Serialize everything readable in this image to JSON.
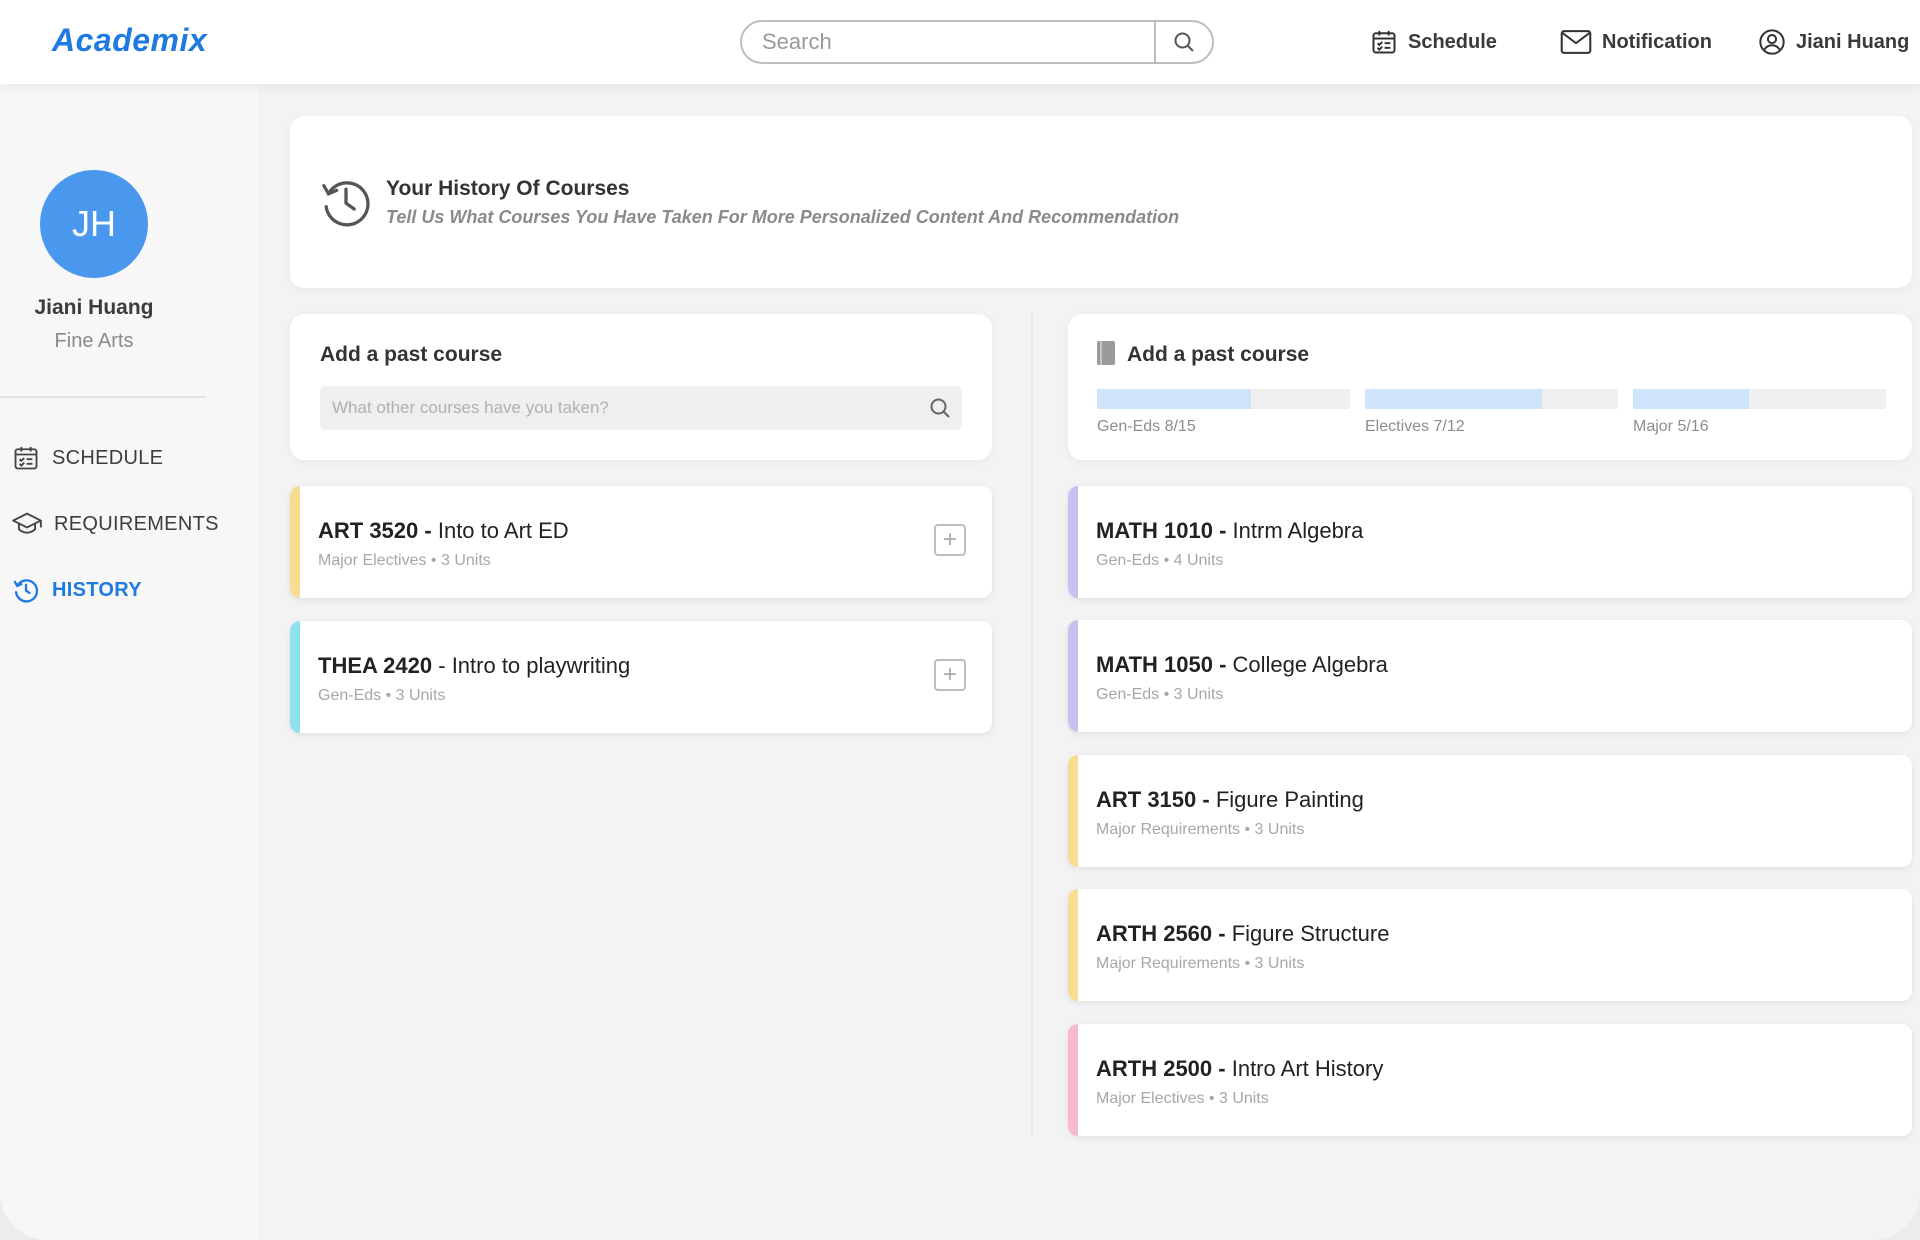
{
  "header": {
    "logo": "Academix",
    "search_placeholder": "Search",
    "nav": {
      "schedule": "Schedule",
      "notification": "Notification",
      "user": "Jiani Huang"
    }
  },
  "sidebar": {
    "avatar_initials": "JH",
    "name": "Jiani Huang",
    "major": "Fine Arts",
    "items": [
      {
        "label": "SCHEDULE",
        "icon": "calendar-icon",
        "active": false
      },
      {
        "label": "REQUIREMENTS",
        "icon": "graduation-cap-icon",
        "active": false
      },
      {
        "label": "HISTORY",
        "icon": "history-icon",
        "active": true
      }
    ]
  },
  "banner": {
    "title": "Your History Of Courses",
    "subtitle": "Tell Us What Courses You Have Taken For More Personalized Content And Recommendation"
  },
  "add_panel": {
    "title": "Add a past course",
    "placeholder": "What other courses have you taken?"
  },
  "progress_panel": {
    "title": "Add a past course",
    "items": [
      {
        "label": "Gen-Eds 8/15",
        "done": 8,
        "total": 15
      },
      {
        "label": "Electives 7/12",
        "done": 7,
        "total": 12
      },
      {
        "label": "Major 5/16",
        "done": 5,
        "total": 16
      }
    ]
  },
  "suggested_courses": [
    {
      "code": "ART 3520 -",
      "name": "Into to Art ED",
      "meta": "Major Electives • 3 Units",
      "color": "#f7dc92"
    },
    {
      "code": "THEA 2420 ",
      "name": " - Intro to playwriting",
      "meta": "Gen-Eds • 3 Units",
      "color": "#8fe1ef"
    }
  ],
  "taken_courses": [
    {
      "code": "MATH 1010 -",
      "name": "Intrm Algebra",
      "meta": "Gen-Eds • 4 Units",
      "color": "#cdbff2"
    },
    {
      "code": "MATH 1050 -",
      "name": "College Algebra",
      "meta": "Gen-Eds • 3 Units",
      "color": "#cdbff2"
    },
    {
      "code": "ART 3150 -",
      "name": "Figure Painting",
      "meta": "Major Requirements • 3 Units",
      "color": "#f7dc92"
    },
    {
      "code": "ARTH 2560 -",
      "name": "Figure Structure",
      "meta": "Major Requirements • 3 Units",
      "color": "#f7dc92"
    },
    {
      "code": "ARTH 2500 -",
      "name": "Intro Art History",
      "meta": "Major Electives • 3 Units",
      "color": "#f7b9cd"
    }
  ],
  "colors": {
    "accent": "#1f7ae0",
    "avatar": "#4a97ee",
    "progress_fill": "#cfe4fb"
  }
}
